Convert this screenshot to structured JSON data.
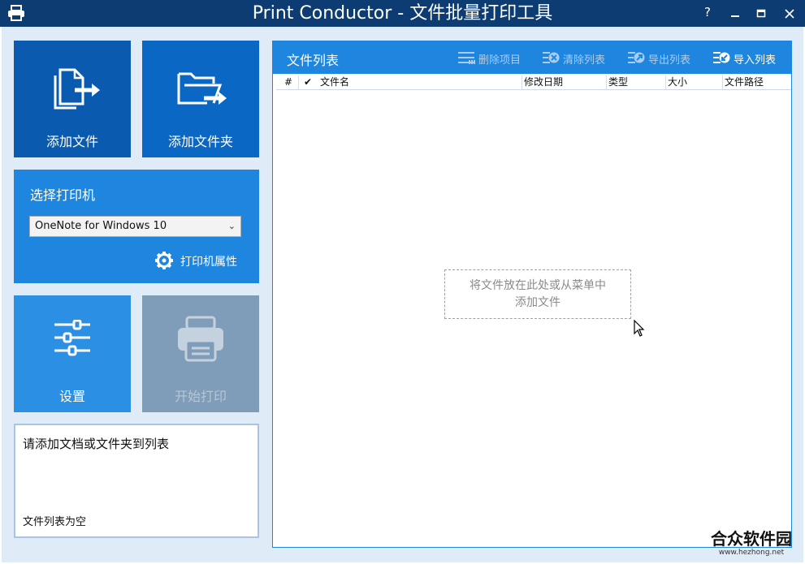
{
  "window": {
    "title": "Print Conductor - 文件批量打印工具",
    "help_label": "?",
    "controls": {
      "minimize": "minimize-icon",
      "maximize": "maximize-icon",
      "close": "close-icon"
    }
  },
  "tiles": {
    "add_file": {
      "label": "添加文件",
      "icon": "add-file-icon",
      "color": "#0a5bb0"
    },
    "add_folder": {
      "label": "添加文件夹",
      "icon": "add-folder-icon",
      "color": "#0a67c4"
    },
    "settings": {
      "label": "设置",
      "icon": "sliders-icon",
      "color": "#2b8fe4"
    },
    "start_print": {
      "label": "开始打印",
      "icon": "printer-icon",
      "color": "#7f9cb8",
      "enabled": false
    }
  },
  "printer": {
    "title": "选择打印机",
    "selected": "OneNote for Windows 10",
    "properties_label": "打印机属性"
  },
  "status": {
    "message": "请添加文档或文件夹到列表",
    "list_state": "文件列表为空"
  },
  "file_list": {
    "title": "文件列表",
    "toolbar": [
      {
        "label": "删除项目",
        "icon": "delete-items-icon",
        "enabled": false
      },
      {
        "label": "清除列表",
        "icon": "clear-list-icon",
        "enabled": false
      },
      {
        "label": "导出列表",
        "icon": "export-list-icon",
        "enabled": false
      },
      {
        "label": "导入列表",
        "icon": "import-list-icon",
        "enabled": true
      }
    ],
    "columns": [
      "#",
      "✔",
      "文件名",
      "修改日期",
      "类型",
      "大小",
      "文件路径"
    ],
    "drop_hint_line1": "将文件放在此处或从菜单中",
    "drop_hint_line2": "添加文件"
  },
  "watermark": {
    "name": "合众软件园",
    "url": "www.hezhong.net"
  }
}
